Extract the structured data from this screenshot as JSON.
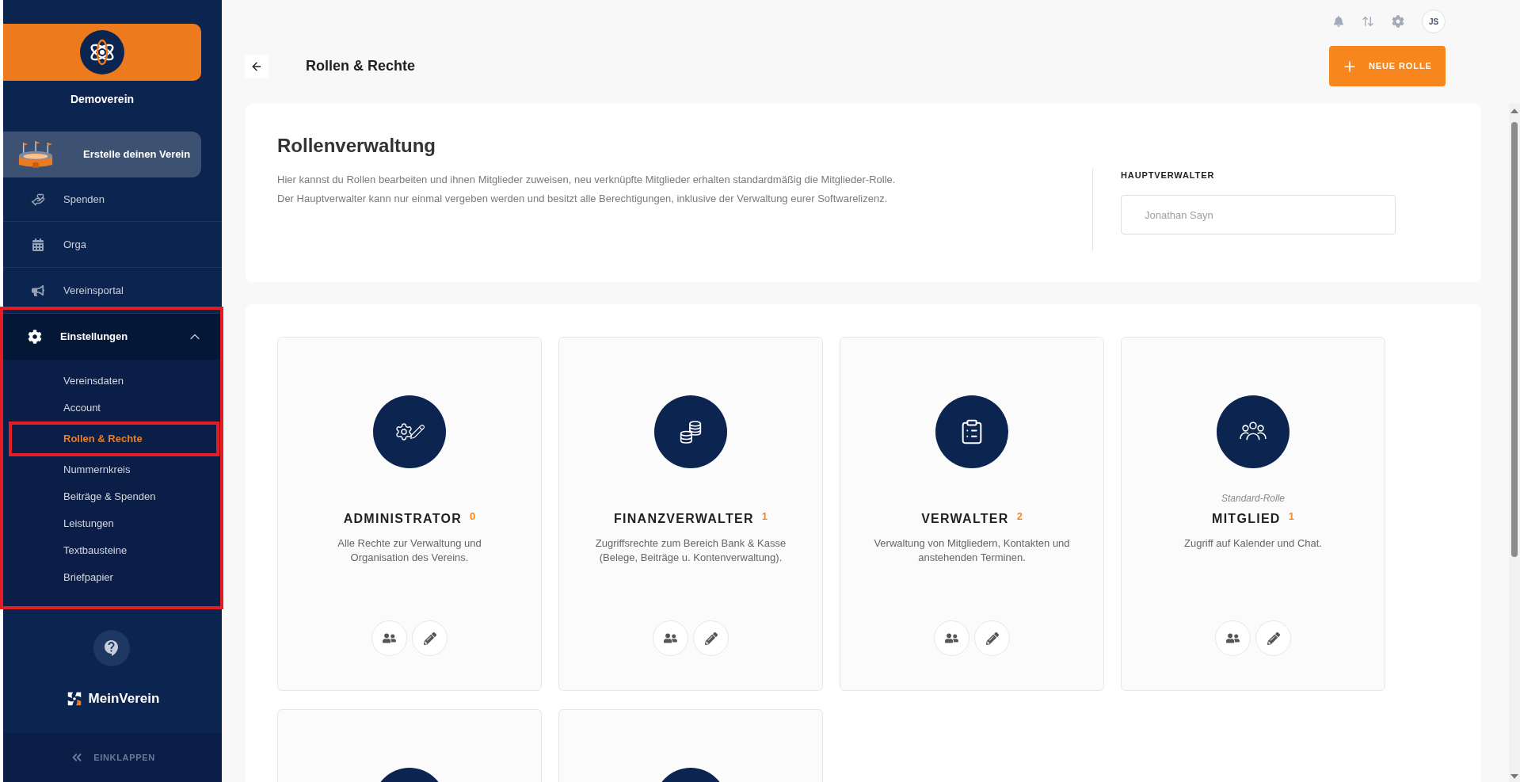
{
  "sidebar": {
    "club_name": "Demoverein",
    "promo": "Erstelle deinen Verein",
    "nav": [
      {
        "label": "Spenden"
      },
      {
        "label": "Orga"
      },
      {
        "label": "Vereinsportal"
      }
    ],
    "settings": {
      "label": "Einstellungen",
      "expanded": true,
      "highlighted": true,
      "items": [
        {
          "label": "Vereinsdaten",
          "selected": false,
          "highlighted": false
        },
        {
          "label": "Account",
          "selected": false,
          "highlighted": false
        },
        {
          "label": "Rollen & Rechte",
          "selected": true,
          "highlighted": true
        },
        {
          "label": "Nummernkreis",
          "selected": false,
          "highlighted": false
        },
        {
          "label": "Beiträge & Spenden",
          "selected": false,
          "highlighted": false
        },
        {
          "label": "Leistungen",
          "selected": false,
          "highlighted": false
        },
        {
          "label": "Textbausteine",
          "selected": false,
          "highlighted": false
        },
        {
          "label": "Briefpapier",
          "selected": false,
          "highlighted": false
        }
      ]
    },
    "brand": "MeinVerein",
    "collapse_label": "EINKLAPPEN"
  },
  "topbar": {
    "avatar": "JS"
  },
  "header": {
    "title": "Rollen & Rechte",
    "new_role_button": "NEUE ROLLE"
  },
  "overview": {
    "title": "Rollenverwaltung",
    "paragraphs": [
      "Hier kannst du Rollen bearbeiten und ihnen Mitglieder zuweisen, neu verknüpfte Mitglieder erhalten standardmäßig die Mitglieder-Rolle.",
      "Der Hauptverwalter kann nur einmal vergeben werden und besitzt alle Berechtigungen, inklusive der Verwaltung eurer Softwarelizenz."
    ],
    "main_admin": {
      "label": "HAUPTVERWALTER",
      "value": "Jonathan Sayn",
      "disabled": true
    }
  },
  "roles": [
    {
      "kind": "role",
      "name": "ADMINISTRATOR",
      "count": "0",
      "description": "Alle Rechte zur Verwaltung und Organisation des Vereins."
    },
    {
      "kind": "role",
      "name": "FINANZVERWALTER",
      "count": "1",
      "description": "Zugriffsrechte zum Bereich Bank & Kasse (Belege, Beiträge u. Kontenverwaltung)."
    },
    {
      "kind": "role",
      "name": "VERWALTER",
      "count": "2",
      "description": "Verwaltung von Mitgliedern, Kontakten und anstehenden Terminen."
    },
    {
      "kind": "role",
      "tag": "Standard-Rolle",
      "name": "MITGLIED",
      "count": "1",
      "description": "Zugriff auf Kalender und Chat."
    },
    {
      "kind": "partial"
    },
    {
      "kind": "partial"
    }
  ]
}
